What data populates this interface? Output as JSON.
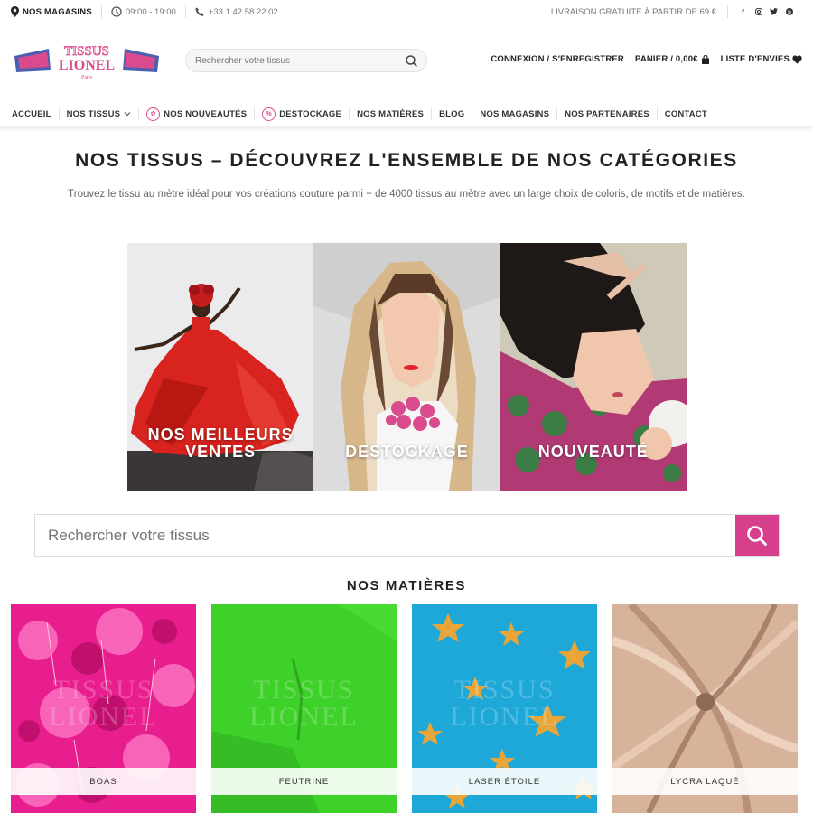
{
  "topbar": {
    "stores": "NOS MAGASINS",
    "hours": "09:00 - 19:00",
    "phone": "+33 1 42 58 22 02",
    "shipping": "LIVRAISON GRATUITE À PARTIR DE 69 €",
    "social": [
      "facebook-icon",
      "instagram-icon",
      "twitter-icon",
      "pinterest-icon"
    ]
  },
  "header": {
    "logo_line1": "TISSUS",
    "logo_line2": "LIONEL",
    "logo_line3": "Paris",
    "search_placeholder": "Rechercher votre tissus",
    "login": "CONNEXION / S'ENREGISTRER",
    "cart": "PANIER / 0,00€",
    "wishlist": "LISTE D'ENVIES"
  },
  "nav": {
    "items": [
      "ACCUEIL",
      "NOS TISSUS",
      "NOS NOUVEAUTÉS",
      "DESTOCKAGE",
      "NOS MATIÈRES",
      "BLOG",
      "NOS MAGASINS",
      "NOS PARTENAIRES",
      "CONTACT"
    ]
  },
  "main": {
    "title": "NOS TISSUS – DÉCOUVREZ L'ENSEMBLE DE NOS CATÉGORIES",
    "subtitle": "Trouvez le tissu au mètre idéal pour vos créations couture parmi + de 4000 tissus au mètre avec un large choix de coloris, de motifs et de matières.",
    "banners": [
      {
        "label_line1": "NOS MEILLEURS",
        "label_line2": "VENTES"
      },
      {
        "label_line1": "DESTOCKAGE",
        "label_line2": ""
      },
      {
        "label_line1": "NOUVEAUTÉ",
        "label_line2": ""
      }
    ],
    "search_placeholder": "Rechercher votre tissus",
    "materials_title": "NOS MATIÈRES",
    "materials": [
      "BOAS",
      "FEUTRINE",
      "LASER ÉTOILE",
      "LYCRA LAQUÉ"
    ],
    "watermark_line1": "TISSUS",
    "watermark_line2": "LIONEL"
  },
  "colors": {
    "accent": "#d63f8c",
    "logo_pink": "#d94b8c",
    "logo_blue": "#4a5fb0"
  }
}
